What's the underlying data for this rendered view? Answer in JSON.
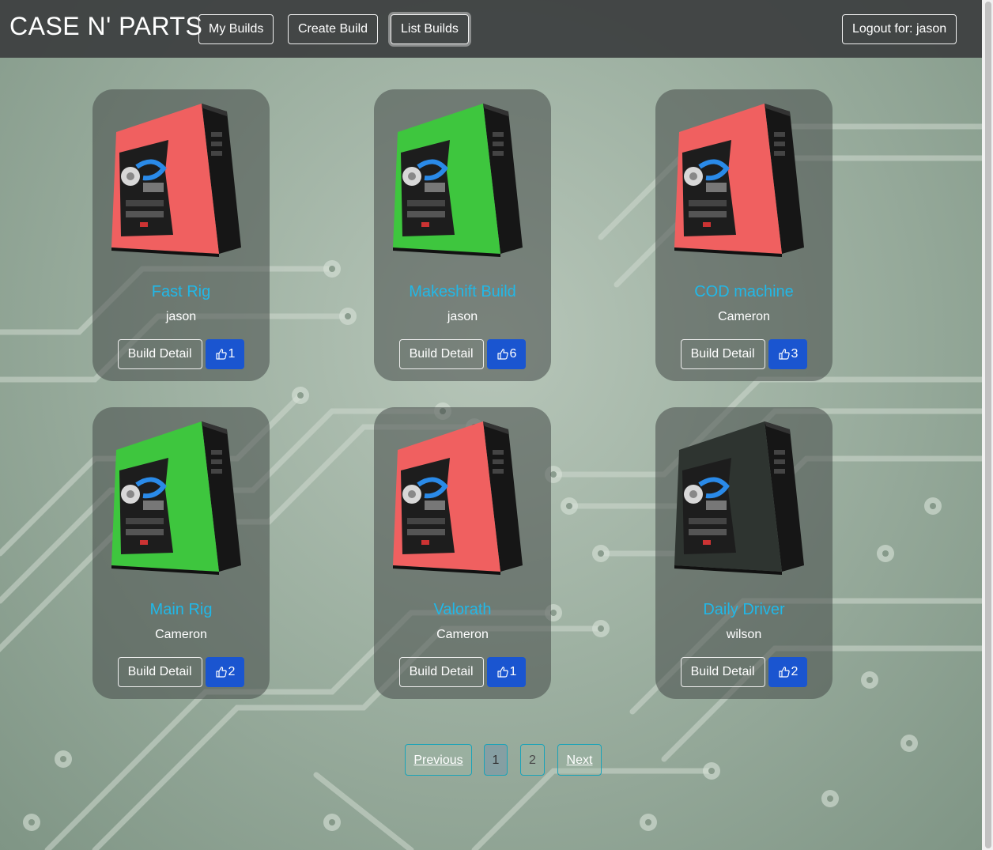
{
  "brand": "CASE N' PARTS",
  "nav": {
    "my_builds": "My Builds",
    "create_build": "Create Build",
    "list_builds": "List Builds",
    "logout": "Logout for: jason"
  },
  "colors": {
    "title": "#21b8e8",
    "like_button": "#1a55d0",
    "navbar": "#3c3e40"
  },
  "builds": [
    {
      "title": "Fast Rig",
      "owner": "jason",
      "detail_label": "Build Detail",
      "likes": "1",
      "case_color": "#f06060"
    },
    {
      "title": "Makeshift Build",
      "owner": "jason",
      "detail_label": "Build Detail",
      "likes": "6",
      "case_color": "#3ec63e"
    },
    {
      "title": "COD machine",
      "owner": "Cameron",
      "detail_label": "Build Detail",
      "likes": "3",
      "case_color": "#f06060"
    },
    {
      "title": "Main Rig",
      "owner": "Cameron",
      "detail_label": "Build Detail",
      "likes": "2",
      "case_color": "#3ec63e"
    },
    {
      "title": "Valorath",
      "owner": "Cameron",
      "detail_label": "Build Detail",
      "likes": "1",
      "case_color": "#f06060"
    },
    {
      "title": "Daily Driver",
      "owner": "wilson",
      "detail_label": "Build Detail",
      "likes": "2",
      "case_color": "#2e3430"
    }
  ],
  "pagination": {
    "previous": "Previous",
    "pages": [
      "1",
      "2"
    ],
    "current": "1",
    "next": "Next"
  },
  "icons": {
    "like": "thumbs-up-icon",
    "build_image": "pc-case-image"
  }
}
